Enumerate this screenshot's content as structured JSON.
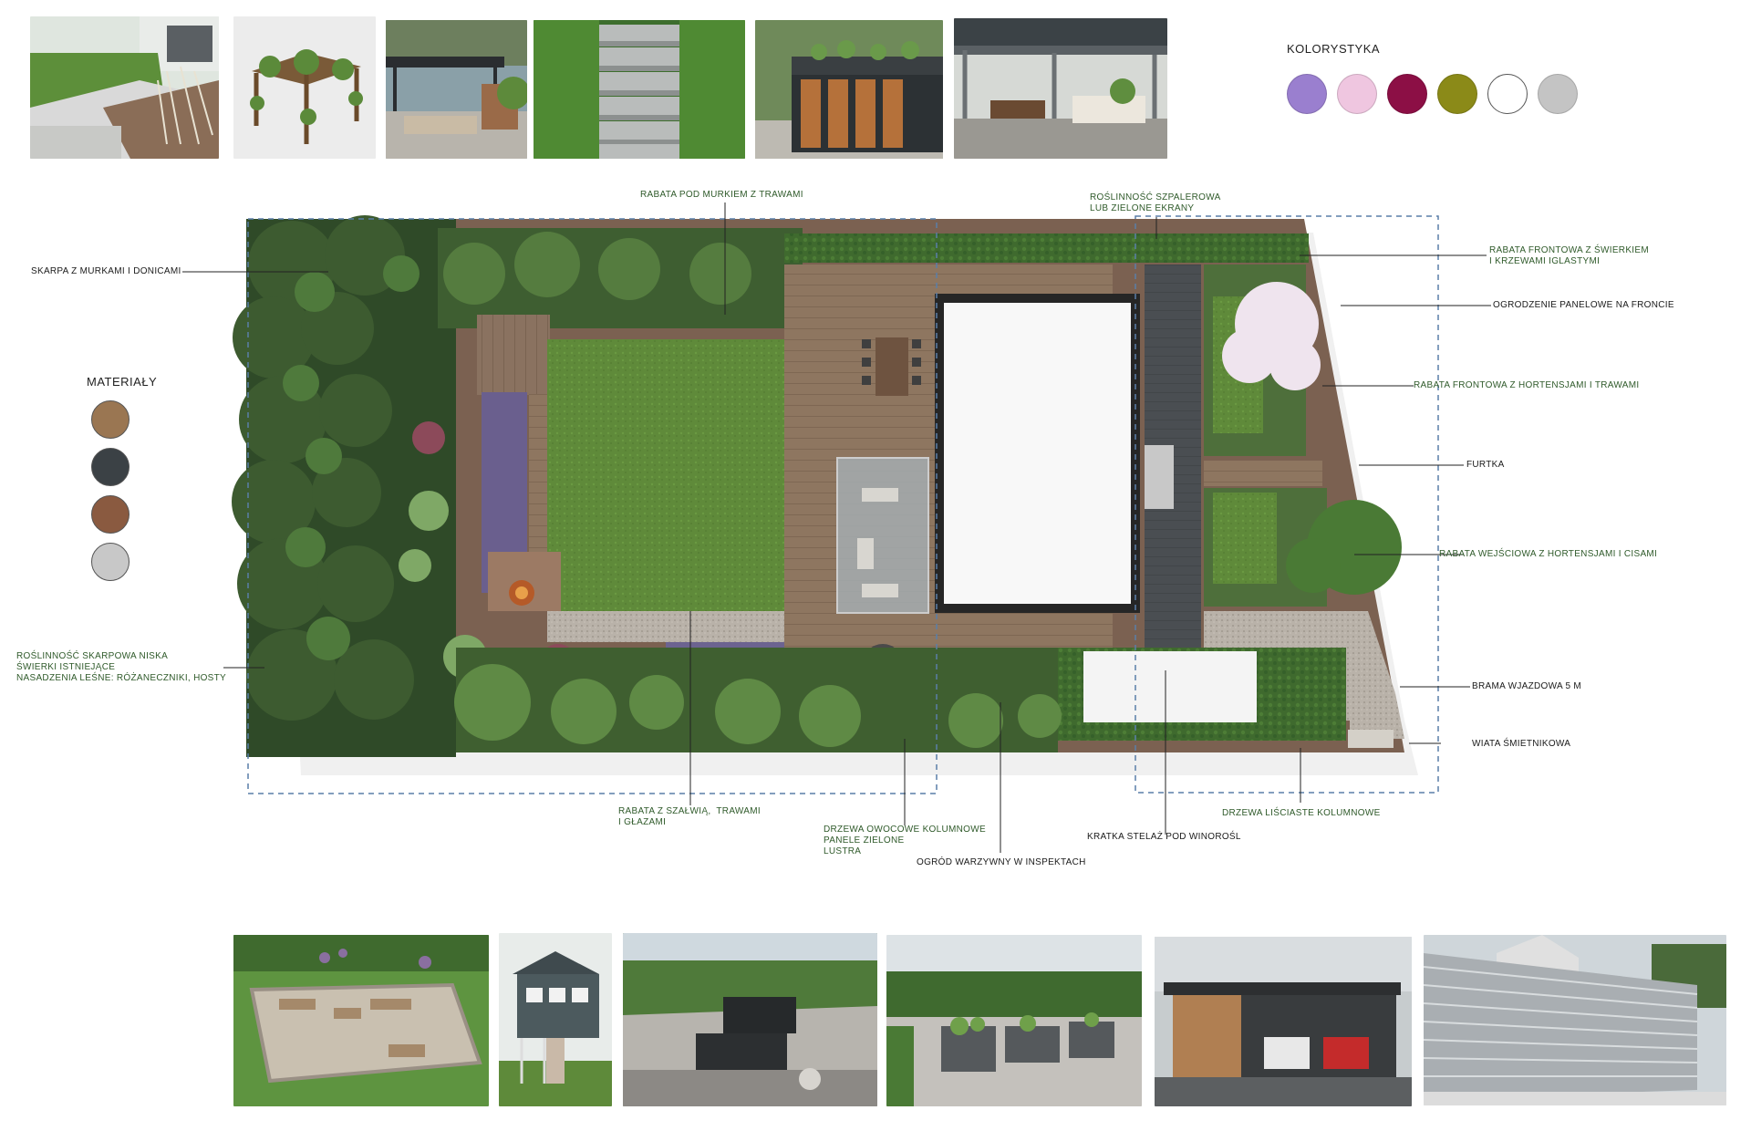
{
  "colors_heading": "KOLORYSTYKA",
  "palette": [
    "#9a7fcf",
    "#efc6e0",
    "#8c0f45",
    "#8b8a18",
    "#ffffff",
    "#c4c4c4"
  ],
  "materials_heading": "MATERIAŁY",
  "materials": [
    {
      "name": "wood",
      "color": "#9a7652"
    },
    {
      "name": "dark-stone",
      "color": "#3b4145"
    },
    {
      "name": "bark-mulch",
      "color": "#8a5a40"
    },
    {
      "name": "light-gravel",
      "color": "#c8c8c8"
    }
  ],
  "annotations": {
    "rabata_pod_murkiem": "RABATA POD MURKIEM Z TRAWAMI",
    "roslinnosc_szpalerowa_1": "ROŚLINNOŚĆ SZPALEROWA",
    "roslinnosc_szpalerowa_2": "LUB ZIELONE EKRANY",
    "skarpa": "SKARPA Z MURKAMI I DONICAMI",
    "rabata_frontowa_swierk_1": "RABATA FRONTOWA Z ŚWIERKIEM",
    "rabata_frontowa_swierk_2": "I KRZEWAMI IGLASTYMI",
    "ogrodzenie": "OGRODZENIE PANELOWE NA FRONCIE",
    "rabata_frontowa_hortensje": "RABATA FRONTOWA Z HORTENSJAMI I TRAWAMI",
    "furtka": "FURTKA",
    "rabata_wejsciowa": "RABATA WEJŚCIOWA Z HORTENSJAMI I CISAMI",
    "skarpowa_1": "ROŚLINNOŚĆ SKARPOWA NISKA",
    "skarpowa_2": "ŚWIERKI ISTNIEJĄCE",
    "skarpowa_3": "NASADZENIA LEŚNE: RÓŻANECZNIKI, HOSTY",
    "brama": "BRAMA WJAZDOWA 5 M",
    "wiata": "WIATA ŚMIETNIKOWA",
    "rabata_szalwia_1": "RABATA Z SZAŁWIĄ,  TRAWAMI",
    "rabata_szalwia_2": "I GŁAZAMI",
    "drzewa_lisciaste": "DRZEWA LIŚCIASTE KOLUMNOWE",
    "drzewa_owocowe_1": "DRZEWA OWOCOWE KOLUMNOWE",
    "drzewa_owocowe_2": "PANELE ZIELONE",
    "drzewa_owocowe_3": "LUSTRA",
    "kratka": "KRATKA STELAŻ POD WINOROŚL",
    "ogrod_warzywny": "OGRÓD WARZYWNY W INSPEKTACH"
  }
}
